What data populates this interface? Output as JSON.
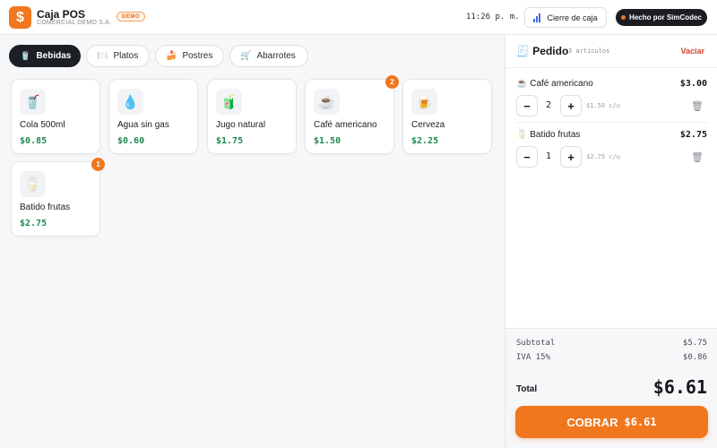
{
  "header": {
    "logo_symbol": "$",
    "title": "Caja POS",
    "subtitle": "COMERCIAL DEMO S.A.",
    "badge": "DEMO",
    "clock": "11:26 p. m.",
    "close_register_label": "Cierre de caja",
    "made_by_label": "Hecho por SimCodec"
  },
  "categories": [
    {
      "label": "Bebidas",
      "icon": "cup-icon",
      "glyph": "🥤",
      "active": true
    },
    {
      "label": "Platos",
      "icon": "plate-icon",
      "glyph": "🍽️",
      "active": false
    },
    {
      "label": "Postres",
      "icon": "cake-icon",
      "glyph": "🍰",
      "active": false
    },
    {
      "label": "Abarrotes",
      "icon": "cart-icon",
      "glyph": "🛒",
      "active": false
    }
  ],
  "products": [
    {
      "name": "Cola 500ml",
      "price": "$0.85",
      "icon": "soda-icon",
      "glyph": "🥤",
      "in_cart": ""
    },
    {
      "name": "Agua sin gas",
      "price": "$0.60",
      "icon": "water-drop-icon",
      "glyph": "💧",
      "in_cart": ""
    },
    {
      "name": "Jugo natural",
      "price": "$1.75",
      "icon": "juice-box-icon",
      "glyph": "🧃",
      "in_cart": ""
    },
    {
      "name": "Café americano",
      "price": "$1.50",
      "icon": "coffee-icon",
      "glyph": "☕",
      "in_cart": "2"
    },
    {
      "name": "Cerveza",
      "price": "$2.25",
      "icon": "beer-icon",
      "glyph": "🍺",
      "in_cart": ""
    },
    {
      "name": "Batido frutas",
      "price": "$2.75",
      "icon": "smoothie-icon",
      "glyph": "🥛",
      "in_cart": "1"
    }
  ],
  "order": {
    "title": "Pedido",
    "title_glyph": "🧾",
    "count": "3 artículos",
    "clear_label": "Vaciar",
    "items": [
      {
        "name": "Café americano",
        "glyph": "☕",
        "qty": "2",
        "unit": "$1.50 c/u",
        "total": "$3.00"
      },
      {
        "name": "Batido frutas",
        "glyph": "🥛",
        "qty": "1",
        "unit": "$2.75 c/u",
        "total": "$2.75"
      }
    ],
    "minus_label": "−",
    "plus_label": "+",
    "trash_glyph": "🗑",
    "subtotal_label": "Subtotal",
    "subtotal": "$5.75",
    "tax_label": "IVA 15%",
    "tax": "$0.86",
    "total_label": "Total",
    "total": "$6.61",
    "pay_label": "COBRAR",
    "pay_amount": "$6.61"
  },
  "colors": {
    "accent": "#f0771e",
    "price_green": "#1e8a4c",
    "danger": "#d6402f",
    "dark": "#1c1f26"
  }
}
